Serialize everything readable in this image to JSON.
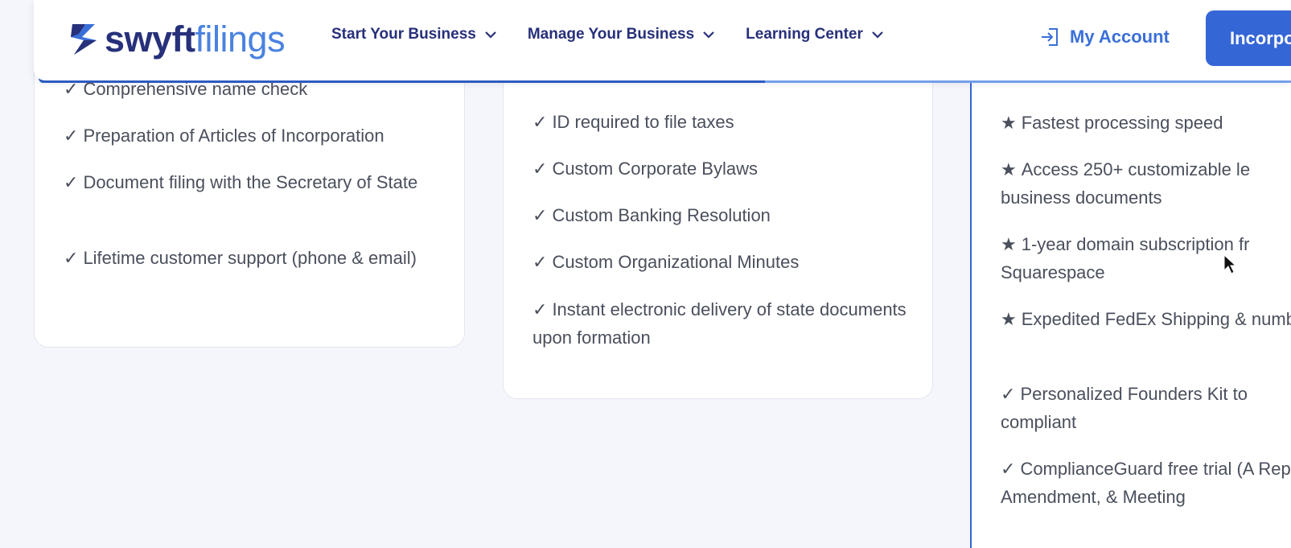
{
  "header": {
    "logo_swyft": "swyft",
    "logo_filings": "filings",
    "nav": [
      {
        "label": "Start Your Business"
      },
      {
        "label": "Manage Your Business"
      },
      {
        "label": "Learning Center"
      }
    ],
    "account_label": "My Account",
    "cta_label": "Incorpo",
    "progress_fraction": 0.58
  },
  "cards": {
    "basic": [
      "Comprehensive name check",
      "Preparation of Articles of Incorporation",
      "Document filing with the Secretary of State",
      "Lifetime customer support (phone & email)"
    ],
    "standard": [
      "ID required to file taxes",
      "Custom Corporate Bylaws",
      "Custom Banking Resolution",
      "Custom Organizational Minutes",
      "Instant electronic delivery of state documents upon formation"
    ],
    "premium": [
      {
        "mark": "★",
        "text": "Fastest processing speed"
      },
      {
        "mark": "★",
        "text": "Access 250+ customizable le business documents"
      },
      {
        "mark": "★",
        "text": "1-year domain subscription fr Squarespace"
      },
      {
        "mark": "★",
        "text": "Expedited FedEx Shipping & number"
      },
      {
        "mark": "✓",
        "text": "Personalized Founders Kit to compliant"
      },
      {
        "mark": "✓",
        "text": "ComplianceGuard free trial (A Report, Amendment, & Meeting"
      }
    ]
  },
  "colors": {
    "brand_dark": "#27307a",
    "brand_blue": "#3466d6",
    "highlight": "#f5cc05"
  }
}
